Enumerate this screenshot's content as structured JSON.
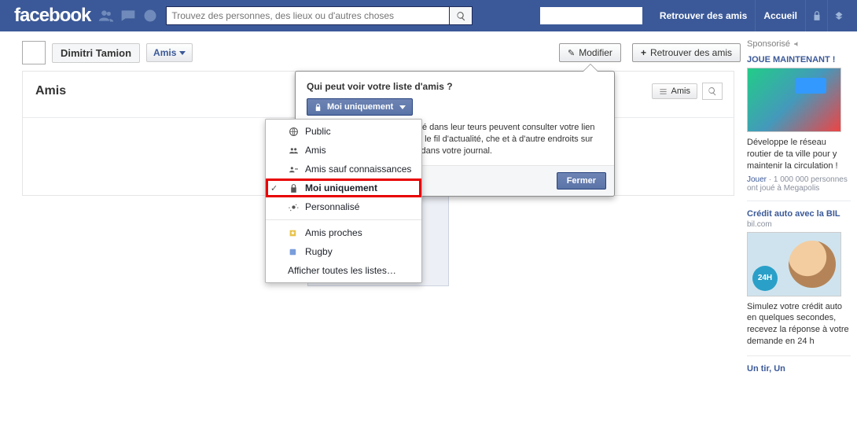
{
  "topbar": {
    "logo": "facebook",
    "search_placeholder": "Trouvez des personnes, des lieux ou d'autres choses",
    "find_friends": "Retrouver des amis",
    "home": "Accueil"
  },
  "profile": {
    "name": "Dimitri Tamion",
    "friends_tab": "Amis",
    "modify_btn": "Modifier",
    "find_friends_btn": "Retrouver des amis"
  },
  "panel": {
    "title": "Amis",
    "group_btn": "Amis"
  },
  "popover": {
    "question": "Qui peut voir votre liste d'amis ?",
    "selector_label": "Moi uniquement",
    "body_text": "qui peut voir leurs liens d'amitié dans leur teurs peuvent consulter votre lien d'amitié urront y accéder dans le fil d'actualité, che et à d'autre endroits sur Facebook. Ils amis communs dans votre journal.",
    "close_btn": "Fermer"
  },
  "menu": {
    "items": [
      {
        "label": "Public",
        "icon": "globe"
      },
      {
        "label": "Amis",
        "icon": "friends"
      },
      {
        "label": "Amis sauf connaissances",
        "icon": "friends-minus"
      },
      {
        "label": "Moi uniquement",
        "icon": "lock",
        "selected": true,
        "checked": true
      },
      {
        "label": "Personnalisé",
        "icon": "gear"
      }
    ],
    "list_items": [
      {
        "label": "Amis proches",
        "icon": "list-star"
      },
      {
        "label": "Rugby",
        "icon": "list-generic"
      }
    ],
    "show_all": "Afficher toutes les listes…"
  },
  "sponsored": {
    "header": "Sponsorisé",
    "ad1_title": "JOUE MAINTENANT !",
    "ad1_text": "Développe le réseau routier de ta ville pour y maintenir la circulation !",
    "ad1_sub_link": "Jouer",
    "ad1_sub_text": " · 1 000 000 personnes ont joué à Megapolis",
    "ad2_title": "Crédit auto avec la BIL",
    "ad2_domain": "bil.com",
    "ad2_badge": "24H",
    "ad2_text": "Simulez votre crédit auto en quelques secondes, recevez la réponse à votre demande en 24 h",
    "ad3_title": "Un tir, Un"
  }
}
